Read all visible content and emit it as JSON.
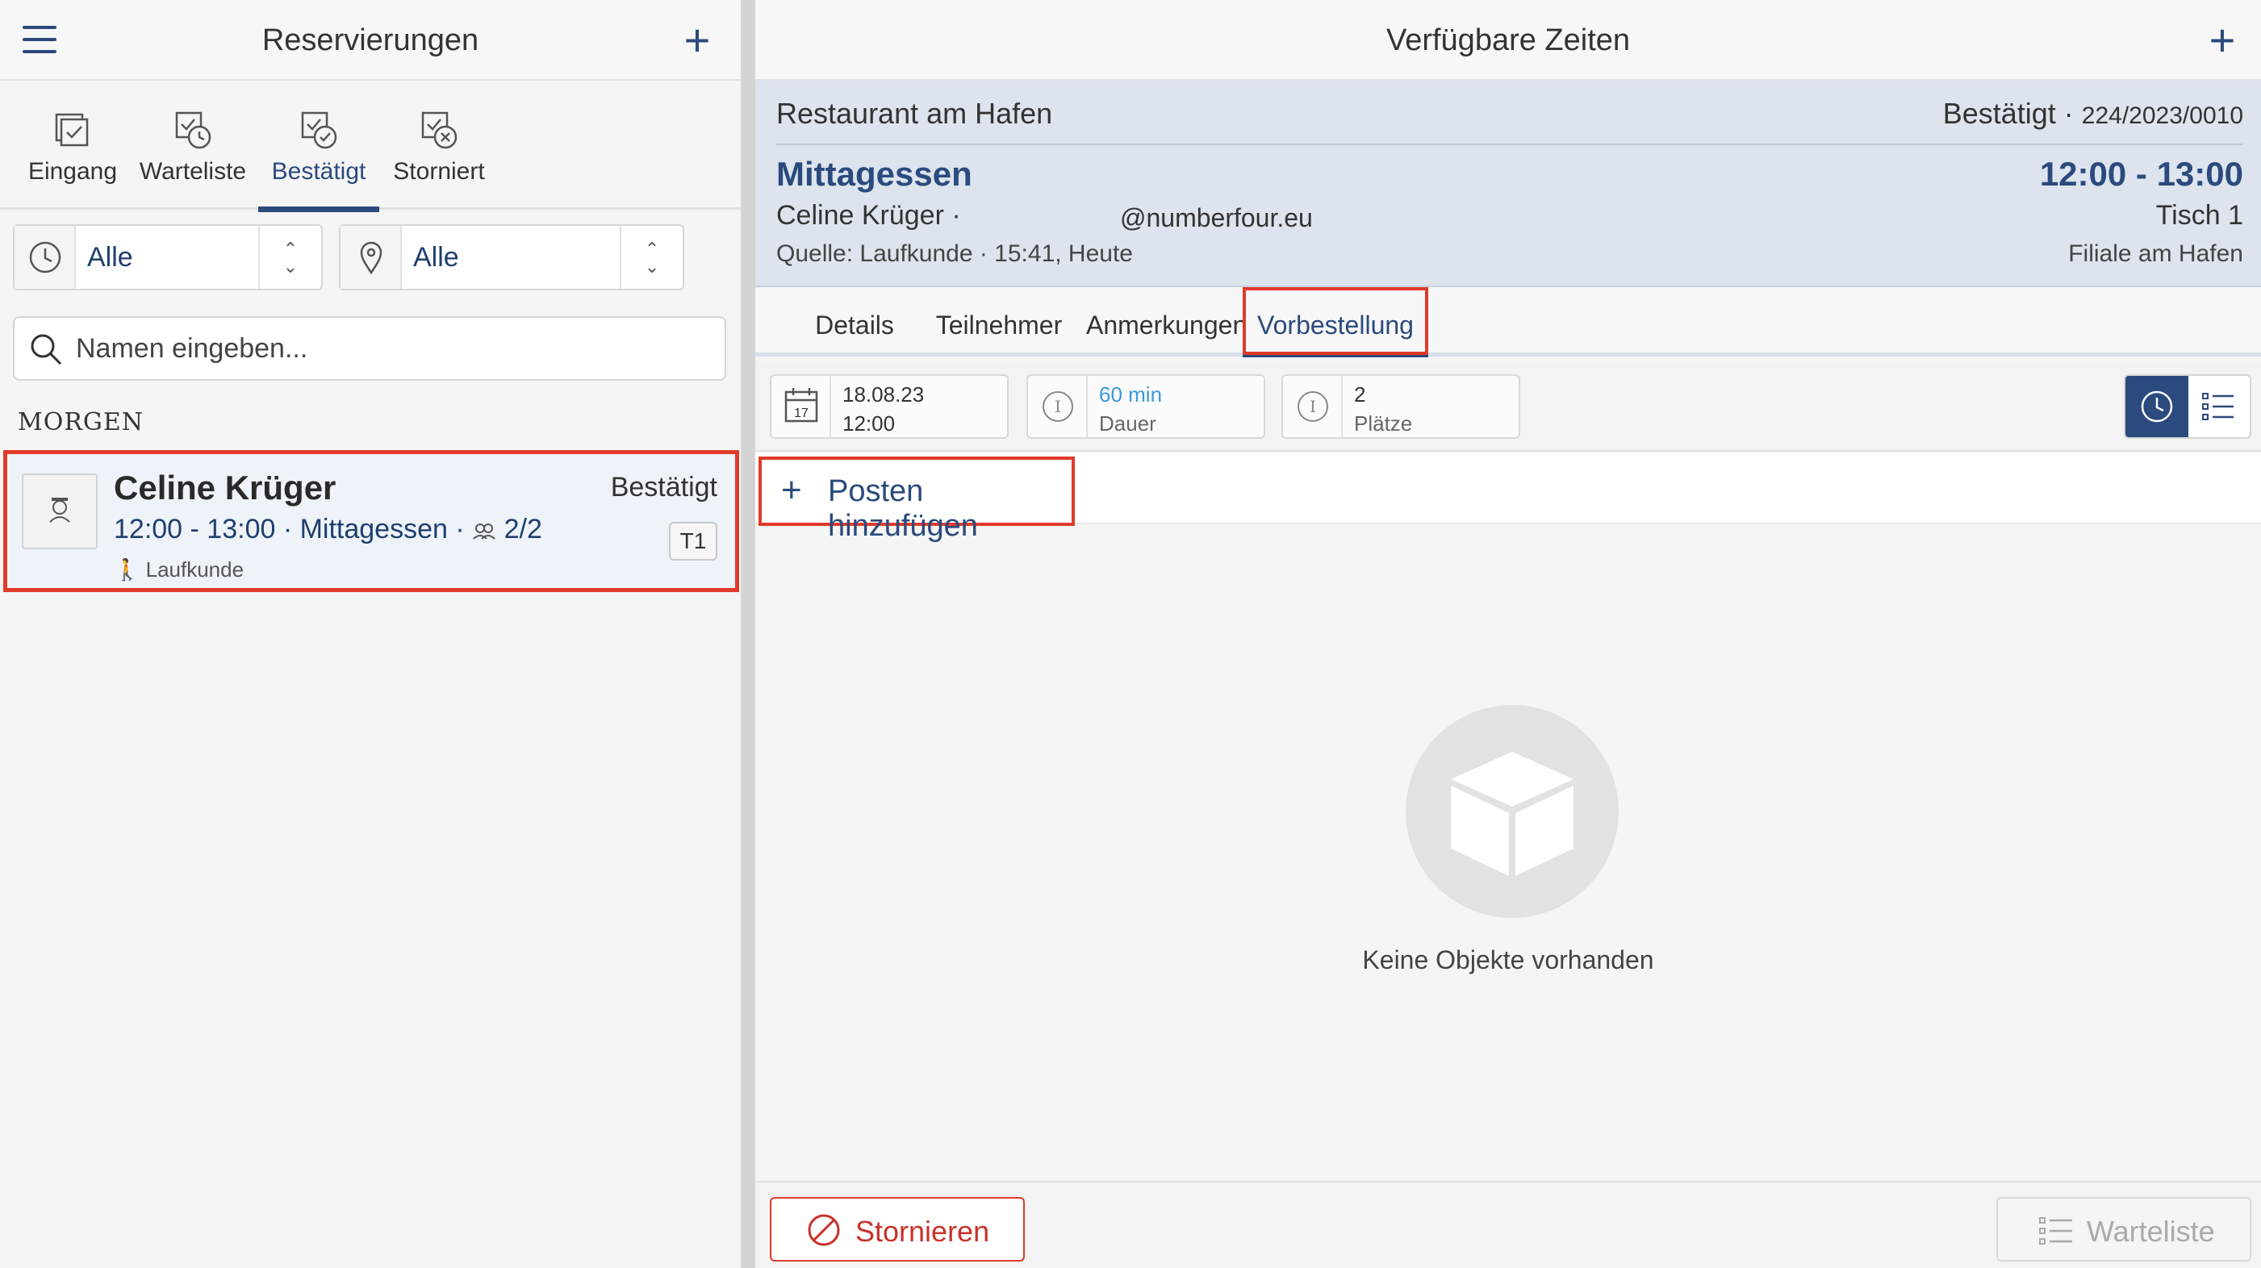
{
  "left": {
    "title": "Reservierungen",
    "tabs": [
      {
        "label": "Eingang",
        "icon": "inbox-icon"
      },
      {
        "label": "Warteliste",
        "icon": "waitlist-clock-icon"
      },
      {
        "label": "Bestätigt",
        "icon": "confirmed-check-icon",
        "active": true
      },
      {
        "label": "Storniert",
        "icon": "cancelled-x-icon"
      }
    ],
    "filters": {
      "time": {
        "value": "Alle",
        "icon": "clock-icon"
      },
      "location": {
        "value": "Alle",
        "icon": "location-pin-icon"
      }
    },
    "search": {
      "placeholder": "Namen eingeben..."
    },
    "section": "MORGEN",
    "reservation": {
      "name": "Celine Krüger",
      "status": "Bestätigt",
      "time_line": "12:00 - 13:00 · Mittagessen ·",
      "guests": "2/2",
      "source": "Laufkunde",
      "table": "T1"
    }
  },
  "right": {
    "title": "Verfügbare Zeiten",
    "header": {
      "venue": "Restaurant am Hafen",
      "status": "Bestätigt ·",
      "code": "224/2023/0010",
      "service": "Mittagessen",
      "time": "12:00 - 13:00",
      "guest": "Celine Krüger ·",
      "email": "@numberfour.eu",
      "table": "Tisch 1",
      "source": "Quelle: Laufkunde · 15:41, Heute",
      "branch": "Filiale am Hafen"
    },
    "tabs": [
      "Details",
      "Teilnehmer",
      "Anmerkungen",
      "Vorbestellung"
    ],
    "active_tab": "Vorbestellung",
    "info": {
      "date": "18.08.23",
      "time": "12:00",
      "calendar_day": "17",
      "duration_value": "60 min",
      "duration_label": "Dauer",
      "seats_value": "2",
      "seats_label": "Plätze"
    },
    "add_item": "Posten hinzufügen",
    "empty_text": "Keine Objekte vorhanden",
    "cancel_button": "Stornieren",
    "waitlist_button": "Warteliste"
  },
  "colors": {
    "accent": "#2b4a7d",
    "highlight": "#e03a2a",
    "link": "#3a9ad9"
  }
}
